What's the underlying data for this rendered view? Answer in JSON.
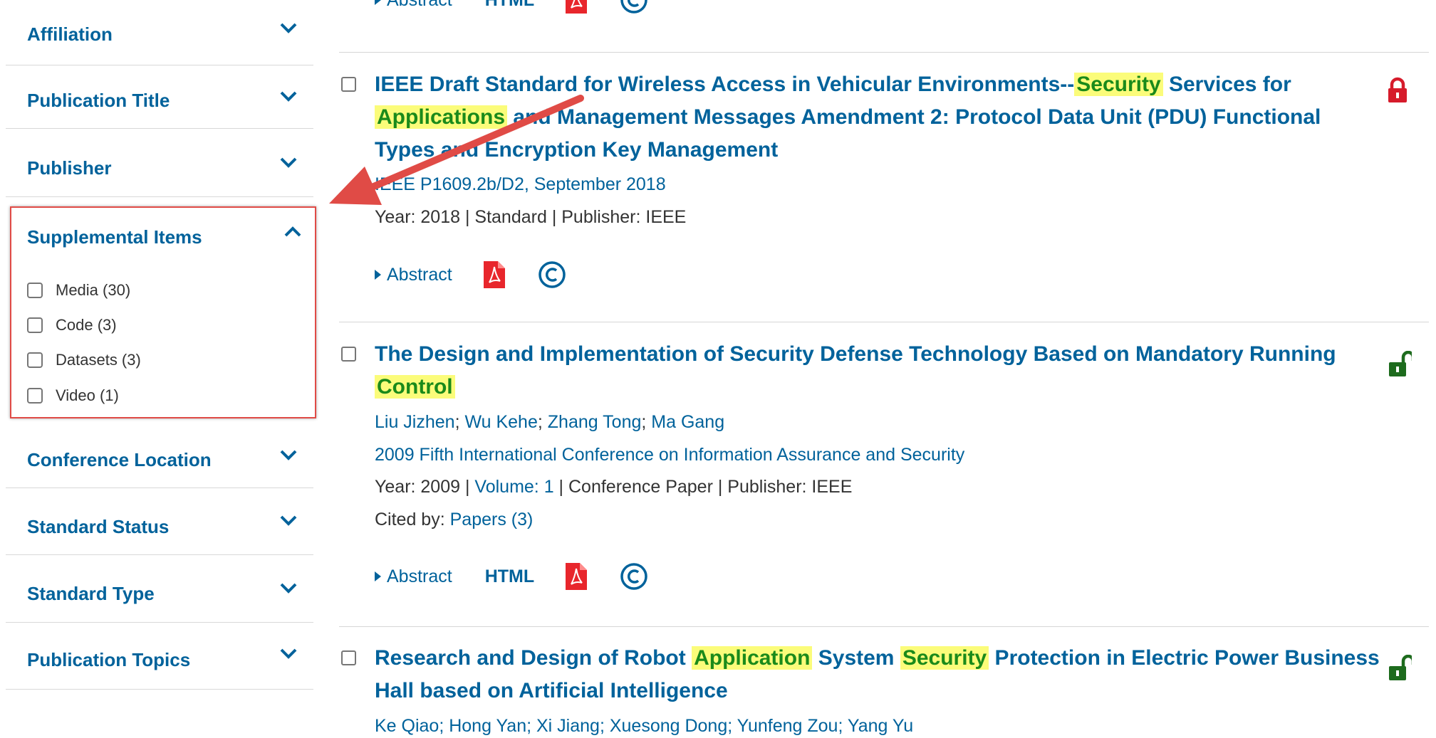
{
  "sidebar": {
    "facets_top": [
      {
        "label": "Affiliation"
      },
      {
        "label": "Publication Title"
      },
      {
        "label": "Publisher"
      }
    ],
    "supplemental": {
      "label": "Supplemental Items",
      "options": [
        {
          "label": "Media (30)"
        },
        {
          "label": "Code (3)"
        },
        {
          "label": "Datasets (3)"
        },
        {
          "label": "Video (1)"
        }
      ]
    },
    "facets_bottom": [
      {
        "label": "Conference Location"
      },
      {
        "label": "Standard Status"
      },
      {
        "label": "Standard Type"
      },
      {
        "label": "Publication Topics"
      }
    ]
  },
  "results": {
    "prev": {
      "abstract": "Abstract",
      "html": "HTML"
    },
    "r1": {
      "title_a": "IEEE Draft Standard for Wireless Access in Vehicular Environments--",
      "hl1": "Security",
      "title_b": " Services for ",
      "hl2": "Applications",
      "title_c": " and Management Messages Amendment 2: Protocol Data Unit (PDU) Functional Types and Encryption Key Management",
      "source": "IEEE P1609.2b/D2, September 2018",
      "meta": "Year: 2018  |  Standard  | Publisher:  IEEE",
      "abstract": "Abstract",
      "access": "locked"
    },
    "r2": {
      "title_a": "The Design and Implementation of Security Defense Technology Based on Mandatory Running ",
      "hl1": "Control",
      "authors": [
        "Liu Jizhen",
        "Wu Kehe",
        "Zhang Tong",
        "Ma Gang"
      ],
      "source": "2009 Fifth International Conference on Information Assurance and Security",
      "year": "Year: 2009",
      "volume": "Volume: 1",
      "type_pub": "Conference Paper  | Publisher:  IEEE",
      "cited_label": "Cited by:",
      "cited_link": "Papers (3)",
      "abstract": "Abstract",
      "html": "HTML",
      "access": "open"
    },
    "r3": {
      "title_a": "Research and Design of Robot ",
      "hl1": "Application",
      "title_b": " System ",
      "hl2": "Security",
      "title_c": " Protection in Electric Power Business Hall based on Artificial Intelligence",
      "authors": "Ke Qiao; Hong Yan; Xi Jiang; Xuesong Dong; Yunfeng Zou; Yang Yu",
      "access": "open"
    }
  },
  "colors": {
    "link": "#00629b",
    "highlight_bg": "#fbfc7a",
    "highlight_text": "#1a8a1a",
    "annotation": "#e04b46",
    "lock_closed": "#d61b2b",
    "lock_open": "#1d6b1d"
  }
}
